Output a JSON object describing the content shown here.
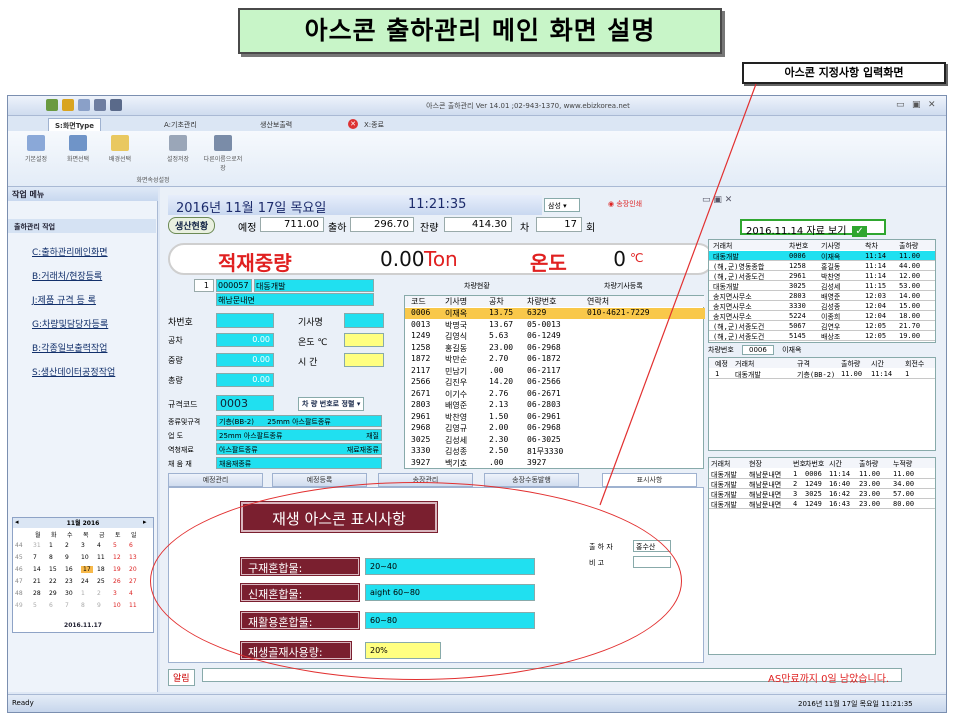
{
  "banner": {
    "title": "아스콘 출하관리 메인 화면 설명"
  },
  "callout": {
    "label": "아스콘 지정사항 입력화면"
  },
  "window": {
    "title": "아스콘 출하관리 Ver 14.01 ;02-943-1370, www.ebizkorea.net",
    "tabs": [
      "S:화면Type",
      "A:기초관리",
      "생산보출력",
      "X:종료"
    ],
    "ribbon_buttons": [
      "기본설정",
      "화면선택",
      "배경선택",
      "설정저장",
      "다른이름으로저장"
    ],
    "ribbon_group": "화면속성설정",
    "status_left": "Ready",
    "status_right": "2016년 11월 17일 목요일 11:21:35"
  },
  "left": {
    "header": "작업 메뉴",
    "sub": "출하관리 작업",
    "menu": [
      "C:출하관리메인화면",
      "B:거래처/현장등록",
      "J:제품 규격 등 록",
      "G:차량및담당자등록",
      "B:각종일보출력작업",
      "S:생산데이터공정작업"
    ],
    "calendar": {
      "title": "11월 2016",
      "weekdays": [
        "월",
        "화",
        "수",
        "목",
        "금",
        "토",
        "일"
      ],
      "weeks": [
        [
          "44",
          "31",
          "1",
          "2",
          "3",
          "4",
          "5",
          "6"
        ],
        [
          "45",
          "7",
          "8",
          "9",
          "10",
          "11",
          "12",
          "13"
        ],
        [
          "46",
          "14",
          "15",
          "16",
          "17",
          "18",
          "19",
          "20"
        ],
        [
          "47",
          "21",
          "22",
          "23",
          "24",
          "25",
          "26",
          "27"
        ],
        [
          "48",
          "28",
          "29",
          "30",
          "1",
          "2",
          "3",
          "4"
        ],
        [
          "49",
          "5",
          "6",
          "7",
          "8",
          "9",
          "10",
          "11"
        ]
      ],
      "today": "2016.11.17"
    }
  },
  "main": {
    "datetime": "2016년 11월 17일 목요일",
    "time": "11:21:35",
    "mode_label": "삼성",
    "print_option": "송장인쇄",
    "bar": {
      "state": "생산현황",
      "plan_label": "예정",
      "plan": "711.00",
      "ship_label": "출하",
      "ship": "296.70",
      "remain_label": "잔량",
      "remain": "414.30",
      "car_label": "차",
      "car": "17",
      "times_label": "회"
    },
    "weight": {
      "label": "적재중량",
      "value": "0.00",
      "unit": "Ton",
      "temp_label": "온도",
      "temp": "0",
      "temp_unit": "℃"
    },
    "form": {
      "seq": "1",
      "code": "000057",
      "client": "대동개발",
      "site": "해남문내면",
      "car_no_label": "차번호",
      "driver_label": "기사명",
      "empty_label": "공차",
      "empty": "0.00",
      "temp_label": "온도 ℃",
      "gross_label": "중량",
      "gross": "0.00",
      "time_label": "시 간",
      "total_label": "총량",
      "total": "0.00",
      "spec_code_label": "규격코드",
      "spec_code": "0003",
      "sort_label": "차 량 번호로 정렬",
      "kind_label": "종류및규격",
      "kind": "기층(BB-2)",
      "kind2": "25mm 아스팔트종류",
      "use_label": "업 도",
      "use": "25mm 아스팔트종류",
      "use2": "재질",
      "mat_label": "역청재료",
      "mat": "아스팔트종류",
      "mat2": "재료재종류",
      "agg_label": "채 움 재",
      "agg": "채움재종류"
    },
    "vehicle_tabs": [
      "차량현황",
      "차량기사등록"
    ],
    "vehicle_headers": [
      "코드",
      "기사명",
      "공차",
      "차량번호",
      "연락처"
    ],
    "vehicles": [
      [
        "0006",
        "이재옥",
        "13.75",
        "6329",
        "010-4621-7229"
      ],
      [
        "0013",
        "박명국",
        "13.67",
        "05-0013",
        ""
      ],
      [
        "1249",
        "김영식",
        "5.63",
        "06-1249",
        ""
      ],
      [
        "1258",
        "홍길동",
        "23.00",
        "06-2968",
        ""
      ],
      [
        "1872",
        "박만순",
        "2.70",
        "06-1872",
        ""
      ],
      [
        "2117",
        "민남기",
        ".00",
        "06-2117",
        ""
      ],
      [
        "2566",
        "김진우",
        "14.20",
        "06-2566",
        ""
      ],
      [
        "2671",
        "이기수",
        "2.76",
        "06-2671",
        ""
      ],
      [
        "2803",
        "배영준",
        "2.13",
        "06-2803",
        ""
      ],
      [
        "2961",
        "박찬영",
        "1.50",
        "06-2961",
        ""
      ],
      [
        "2968",
        "김영규",
        "2.00",
        "06-2968",
        ""
      ],
      [
        "3025",
        "김성세",
        "2.30",
        "06-3025",
        ""
      ],
      [
        "3330",
        "김성종",
        "2.50",
        "81무3330",
        ""
      ],
      [
        "3927",
        "백기호",
        ".00",
        "3927",
        ""
      ]
    ],
    "bottom_tabs": [
      "예정관리",
      "예정등록",
      "송장관리",
      "송장수동발행",
      "표시사항"
    ],
    "notice": {
      "title": "재생 아스콘 표시사항",
      "rows": [
        {
          "label": "구재혼합물:",
          "value": "20~40"
        },
        {
          "label": "신재혼합물:",
          "value": "aight 60~80"
        },
        {
          "label": "재활용혼합물:",
          "value": "60~80"
        },
        {
          "label": "재생골재사용량:",
          "value": "20%"
        }
      ],
      "shipper_label": "출 하 자",
      "shipper": "홍수산",
      "remark_label": "비 고"
    },
    "alert_label": "알림",
    "alert_text": "AS만료까지 0일 남았습니다."
  },
  "right": {
    "date_btn": "2016.11.14 자료 보기",
    "top_headers": [
      "거래처",
      "차번호",
      "기사명",
      "착차",
      "출하량"
    ],
    "top_rows": [
      [
        "대동개발",
        "0006",
        "이재옥",
        "11:14",
        "11.00"
      ],
      [
        "(해,군)영동종합",
        "1258",
        "홍길동",
        "11:14",
        "44.00"
      ],
      [
        "(해,군)서종도건",
        "2961",
        "박찬영",
        "11:14",
        "12.00"
      ],
      [
        "대동개발",
        "3025",
        "김성세",
        "11:15",
        "53.00"
      ],
      [
        "송지면사무소",
        "2803",
        "배영준",
        "12:03",
        "14.00"
      ],
      [
        "송지면사무소",
        "3330",
        "김성종",
        "12:04",
        "15.00"
      ],
      [
        "송지면사무소",
        "5224",
        "이종희",
        "12:04",
        "18.00"
      ],
      [
        "(해,군)서종도건",
        "5067",
        "김연우",
        "12:05",
        "21.70"
      ],
      [
        "(해,군)서종도건",
        "5145",
        "배상조",
        "12:05",
        "19.00"
      ]
    ],
    "car_row_label": "차량번호",
    "car_row_code": "0006",
    "car_row_name": "이재옥",
    "mid_headers": [
      "예정",
      "거래처",
      "규격",
      "출하량",
      "시간",
      "회전수"
    ],
    "mid_rows": [
      [
        "1",
        "대동개발",
        "기층(BB-2)",
        "11.00",
        "11:14",
        "1"
      ]
    ],
    "bot_headers": [
      "거래처",
      "현장",
      "번호",
      "차번호",
      "시간",
      "출하량",
      "누적량"
    ],
    "bot_rows": [
      [
        "대동개발",
        "해남문내면",
        "1",
        "0006",
        "11:14",
        "11.00",
        "11.00"
      ],
      [
        "대동개발",
        "해남문내면",
        "2",
        "1249",
        "16:40",
        "23.00",
        "34.00"
      ],
      [
        "대동개발",
        "해남문내면",
        "3",
        "3025",
        "16:42",
        "23.00",
        "57.00"
      ],
      [
        "대동개발",
        "해남문내면",
        "4",
        "1249",
        "16:43",
        "23.00",
        "80.00"
      ]
    ]
  }
}
